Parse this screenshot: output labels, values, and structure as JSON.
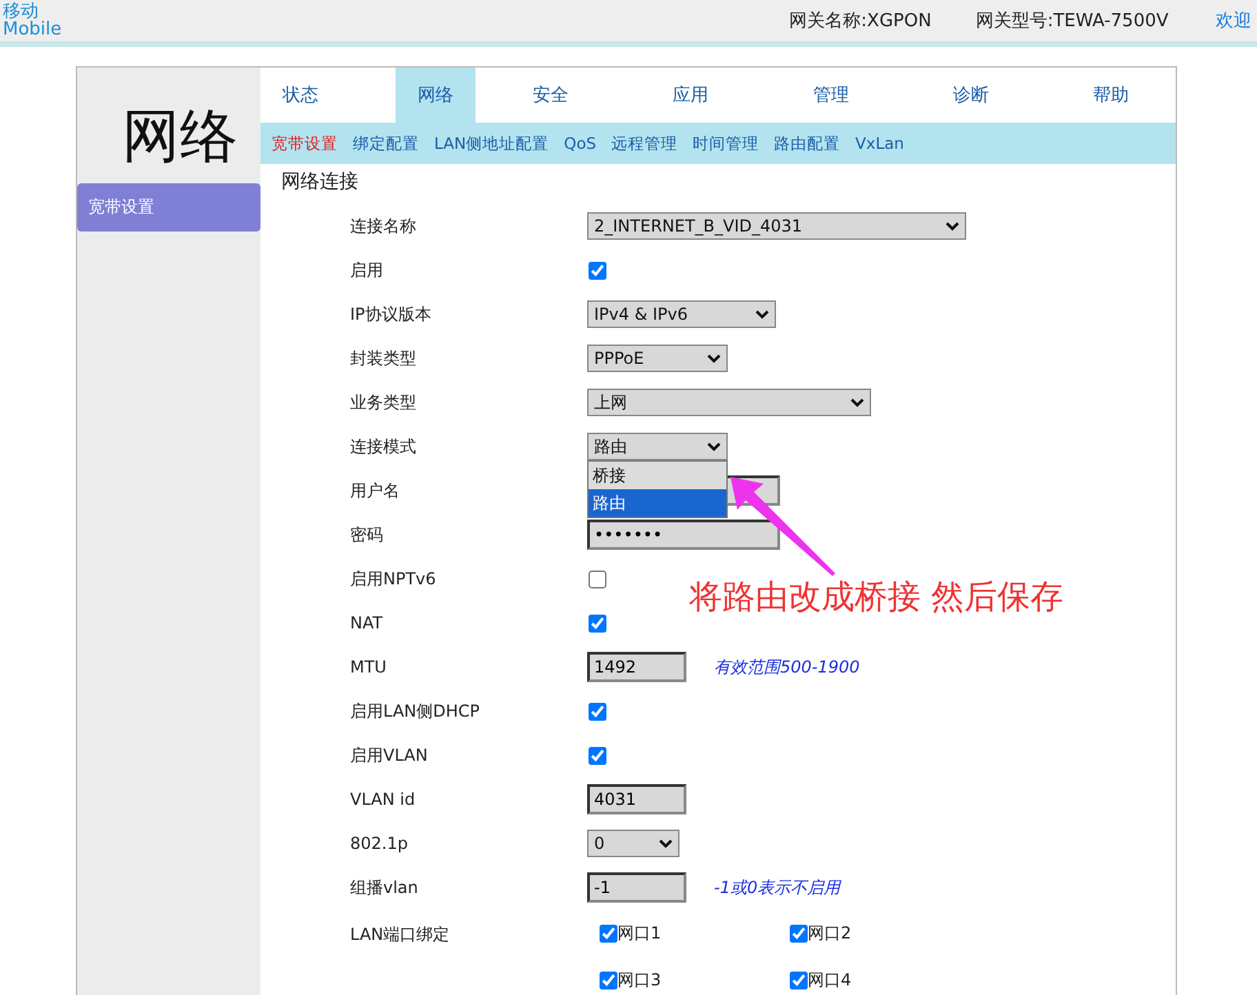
{
  "header": {
    "logo_top": "移动",
    "logo_bottom": "Mobile",
    "gateway_name": "网关名称:XGPON",
    "gateway_model": "网关型号:TEWA-7500V",
    "welcome": "欢迎"
  },
  "tabs": [
    {
      "label": "状态",
      "selected": false
    },
    {
      "label": "网络",
      "selected": true
    },
    {
      "label": "安全",
      "selected": false
    },
    {
      "label": "应用",
      "selected": false
    },
    {
      "label": "管理",
      "selected": false
    },
    {
      "label": "诊断",
      "selected": false
    },
    {
      "label": "帮助",
      "selected": false
    }
  ],
  "subtabs": [
    {
      "label": "宽带设置",
      "selected": true
    },
    {
      "label": "绑定配置",
      "selected": false
    },
    {
      "label": "LAN侧地址配置",
      "selected": false
    },
    {
      "label": "QoS",
      "selected": false
    },
    {
      "label": "远程管理",
      "selected": false
    },
    {
      "label": "时间管理",
      "selected": false
    },
    {
      "label": "路由配置",
      "selected": false
    },
    {
      "label": "VxLan",
      "selected": false
    }
  ],
  "page_title": "网络",
  "sidebar": {
    "items": [
      {
        "label": "宽带设置",
        "selected": true
      }
    ]
  },
  "section_title": "网络连接",
  "fields": [
    {
      "label": "连接名称",
      "kind": "select",
      "value": "2_INTERNET_B_VID_4031"
    },
    {
      "label": "启用",
      "kind": "checkbox",
      "checked": true
    },
    {
      "label": "IP协议版本",
      "kind": "select",
      "value": "IPv4 & IPv6"
    },
    {
      "label": "封装类型",
      "kind": "select",
      "value": "PPPoE"
    },
    {
      "label": "业务类型",
      "kind": "select",
      "value": "上网"
    },
    {
      "label": "连接模式",
      "kind": "select",
      "value": "路由",
      "open": true,
      "options": [
        {
          "label": "桥接",
          "selected": false
        },
        {
          "label": "路由",
          "selected": true
        }
      ]
    },
    {
      "label": "用户名",
      "kind": "text"
    },
    {
      "label": "密码",
      "kind": "text",
      "value": "•••••••"
    },
    {
      "label": "启用NPTv6",
      "kind": "checkbox",
      "checked": false
    },
    {
      "label": "NAT",
      "kind": "checkbox",
      "checked": true
    },
    {
      "label": "MTU",
      "kind": "text",
      "value": "1492",
      "hint": "有效范围500-1900"
    },
    {
      "label": "启用LAN侧DHCP",
      "kind": "checkbox",
      "checked": true
    },
    {
      "label": "启用VLAN",
      "kind": "checkbox",
      "checked": true
    },
    {
      "label": "VLAN id",
      "kind": "text",
      "value": "4031"
    },
    {
      "label": "802.1p",
      "kind": "select",
      "value": "0"
    },
    {
      "label": "组播vlan",
      "kind": "text",
      "value": "-1",
      "hint": "-1或0表示不启用"
    },
    {
      "label": "LAN端口绑定",
      "kind": "ports",
      "ports": [
        {
          "label": "网口1",
          "checked": true
        },
        {
          "label": "网口2",
          "checked": true
        },
        {
          "label": "网口3",
          "checked": true
        },
        {
          "label": "网口4",
          "checked": true
        }
      ]
    }
  ],
  "annotation": {
    "text": "将路由改成桥接 然后保存"
  }
}
